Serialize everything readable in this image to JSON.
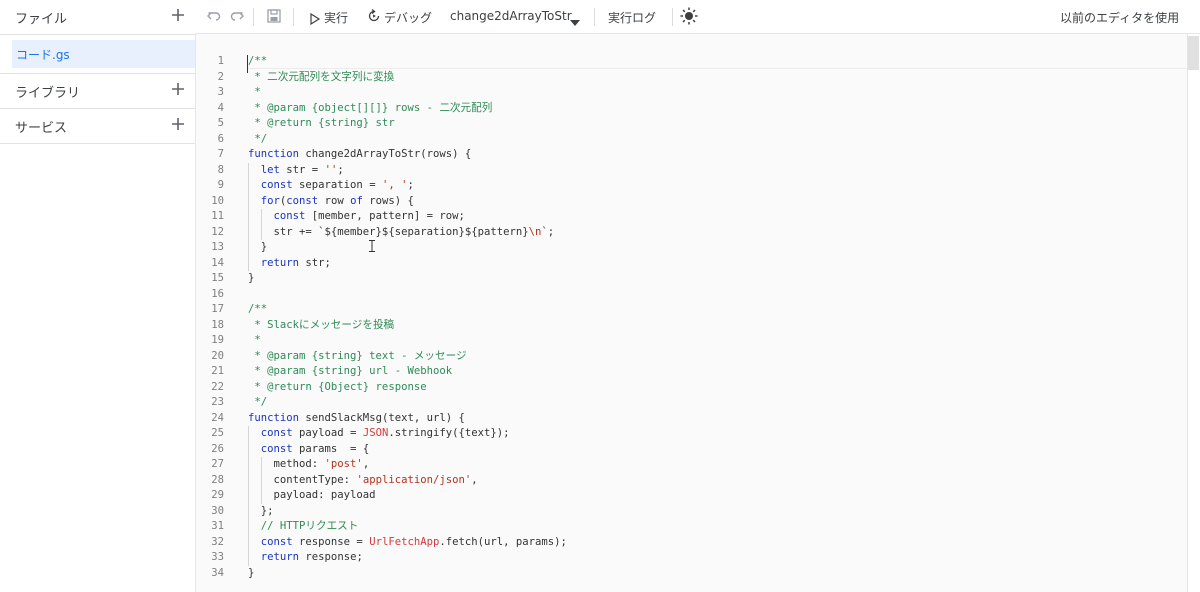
{
  "sidebar": {
    "files_label": "ファイル",
    "file_name": "コード.gs",
    "libraries_label": "ライブラリ",
    "services_label": "サービス"
  },
  "toolbar": {
    "run_label": "実行",
    "debug_label": "デバッグ",
    "function_select": "change2dArrayToStr",
    "exec_log_label": "実行ログ",
    "legacy_editor_label": "以前のエディタを使用"
  },
  "code_lines": [
    "/**",
    " * 二次元配列を文字列に変換",
    " *",
    " * @param {object[][]} rows - 二次元配列",
    " * @return {string} str",
    " */",
    "function change2dArrayToStr(rows) {",
    "  let str = '';",
    "  const separation = ', ';",
    "  for(const row of rows) {",
    "    const [member, pattern] = row;",
    "    str += `${member}${separation}${pattern}\\n`;",
    "  }",
    "  return str;",
    "}",
    "",
    "/**",
    " * Slackにメッセージを投稿",
    " *",
    " * @param {string} text - メッセージ",
    " * @param {string} url - Webhook",
    " * @return {Object} response",
    " */",
    "function sendSlackMsg(text, url) {",
    "  const payload = JSON.stringify({text});",
    "  const params  = {",
    "    method: 'post',",
    "    contentType: 'application/json',",
    "    payload: payload",
    "  };",
    "  // HTTPリクエスト",
    "  const response = UrlFetchApp.fetch(url, params);",
    "  return response;",
    "}"
  ]
}
